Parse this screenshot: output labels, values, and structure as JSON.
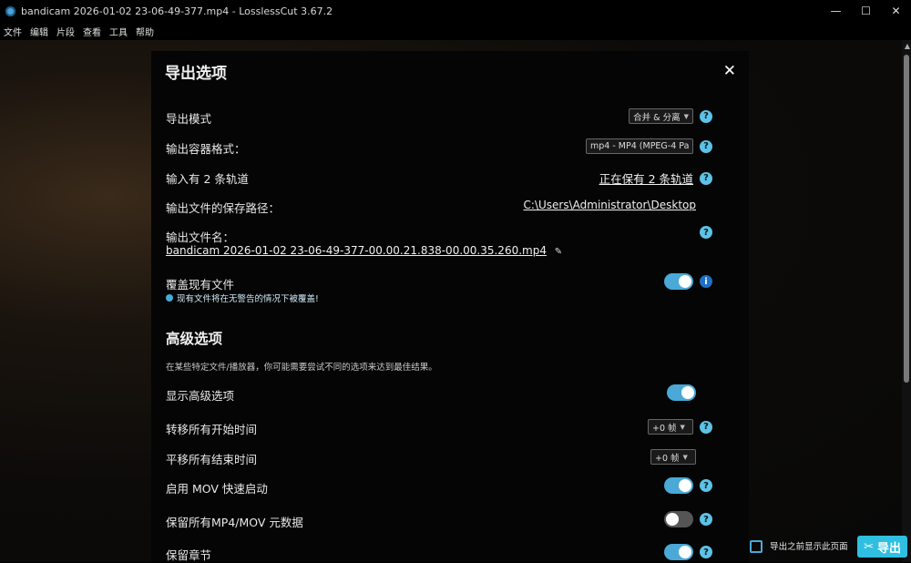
{
  "window": {
    "title": "bandicam 2026-01-02 23-06-49-377.mp4 - LosslessCut 3.67.2",
    "minimize": "—",
    "maximize": "☐",
    "close": "✕"
  },
  "menu": [
    "文件",
    "编辑",
    "片段",
    "查看",
    "工具",
    "帮助"
  ],
  "dialog": {
    "title": "导出选项",
    "close": "✕",
    "export_mode": {
      "label": "导出模式",
      "value": "合并 & 分离"
    },
    "container": {
      "label": "输出容器格式：",
      "value": "mp4 - MP4 (MPEG-4 Pa"
    },
    "tracks": {
      "label": "输入有 2 条轨道",
      "value": "正在保有 2 条轨道"
    },
    "save_path": {
      "label": "输出文件的保存路径：",
      "value": "C:\\Users\\Administrator\\Desktop"
    },
    "filename": {
      "label": "输出文件名：",
      "value": "bandicam 2026-01-02 23-06-49-377-00.00.21.838-00.00.35.260.mp4"
    },
    "overwrite": {
      "label": "覆盖现有文件",
      "note": "现有文件将在无警告的情况下被覆盖!",
      "on": true
    },
    "advanced": {
      "title": "高级选项",
      "description": "在某些特定文件/播放器，你可能需要尝试不同的选项来达到最佳结果。",
      "show_advanced": {
        "label": "显示高级选项",
        "on": true
      },
      "shift_start": {
        "label": "转移所有开始时间",
        "value": "+0 帧"
      },
      "shift_end": {
        "label": "平移所有结束时间",
        "value": "+0 帧"
      },
      "mov_faststart": {
        "label": "启用 MOV 快速启动",
        "on": true
      },
      "preserve_meta": {
        "label": "保留所有MP4/MOV 元数据",
        "on": false
      },
      "preserve_chapters": {
        "label": "保留章节",
        "on": true
      }
    }
  },
  "bottom": {
    "show_before_export": "导出之前显示此页面",
    "export": "导出"
  },
  "colors": {
    "accent": "#4aa9d6",
    "help": "#5dc2e6",
    "export": "#2fbfe0"
  },
  "icons": {
    "help": "?",
    "info": "i",
    "edit": "✎",
    "scissors": "✂"
  }
}
